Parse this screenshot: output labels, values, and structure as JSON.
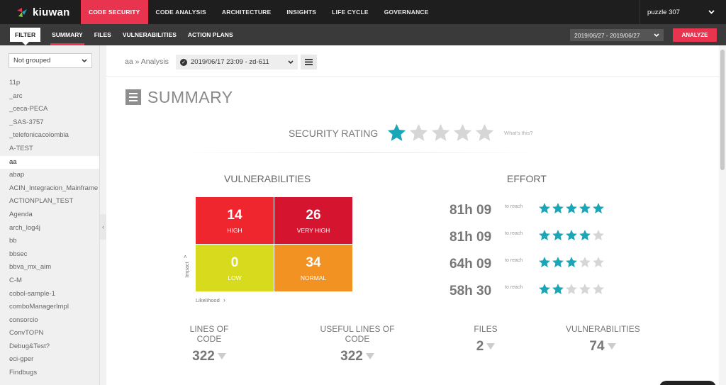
{
  "brand": {
    "name": "kiuwan"
  },
  "topnav": {
    "items": [
      "CODE SECURITY",
      "CODE ANALYSIS",
      "ARCHITECTURE",
      "INSIGHTS",
      "LIFE CYCLE",
      "GOVERNANCE"
    ],
    "active": "CODE SECURITY",
    "project": "puzzle 307"
  },
  "subnav": {
    "filter": "FILTER",
    "items": [
      "SUMMARY",
      "FILES",
      "VULNERABILITIES",
      "ACTION PLANS"
    ],
    "active": "SUMMARY",
    "date_range": "2019/06/27 - 2019/06/27",
    "analyze": "ANALYZE"
  },
  "sidebar": {
    "grouping": "Not grouped",
    "projects": [
      "11p",
      "_arc",
      "_ceca-PECA",
      "_SAS-3757",
      "_telefonicacolombia",
      "A-TEST",
      "aa",
      "abap",
      "ACIN_Integracion_Mainframe",
      "ACTIONPLAN_TEST",
      "Agenda",
      "arch_log4j",
      "bb",
      "bbsec",
      "bbva_mx_aim",
      "C-M",
      "cobol-sample-1",
      "comboManagerImpl",
      "consorcio",
      "ConvTOPN",
      "Debug&Test?",
      "eci-gper",
      "Findbugs"
    ],
    "selected": "aa"
  },
  "breadcrumb": {
    "project": "aa",
    "separator": "»",
    "section": "Analysis"
  },
  "analysis": {
    "label": "2019/06/17 23:09 - zd-611"
  },
  "summary": {
    "title": "SUMMARY",
    "security_rating_label": "SECURITY RATING",
    "security_rating": 1,
    "security_rating_max": 5,
    "whats_this": "What's this?"
  },
  "vulnerabilities": {
    "title": "VULNERABILITIES",
    "high": {
      "value": "14",
      "label": "HIGH"
    },
    "very_high": {
      "value": "26",
      "label": "VERY HIGH"
    },
    "low": {
      "value": "0",
      "label": "LOW"
    },
    "normal": {
      "value": "34",
      "label": "NORMAL"
    },
    "y_axis": "Impact",
    "x_axis": "Likelihood"
  },
  "effort": {
    "title": "EFFORT",
    "to_reach": "to reach",
    "rows": [
      {
        "time": "81h 09",
        "stars": 5
      },
      {
        "time": "81h 09",
        "stars": 4
      },
      {
        "time": "64h 09",
        "stars": 3
      },
      {
        "time": "58h 30",
        "stars": 2
      }
    ]
  },
  "metrics": [
    {
      "label": "LINES OF CODE",
      "value": "322"
    },
    {
      "label": "USEFUL LINES OF CODE",
      "value": "322"
    },
    {
      "label": "FILES",
      "value": "2"
    },
    {
      "label": "VULNERABILITIES",
      "value": "74"
    }
  ],
  "colors": {
    "accent": "#e8344e",
    "star_on": "#1aa6b7",
    "star_off": "#d6d6d6",
    "high": "#f0262e",
    "very_high": "#d5152f",
    "low": "#d8da1e",
    "normal": "#f19223"
  }
}
